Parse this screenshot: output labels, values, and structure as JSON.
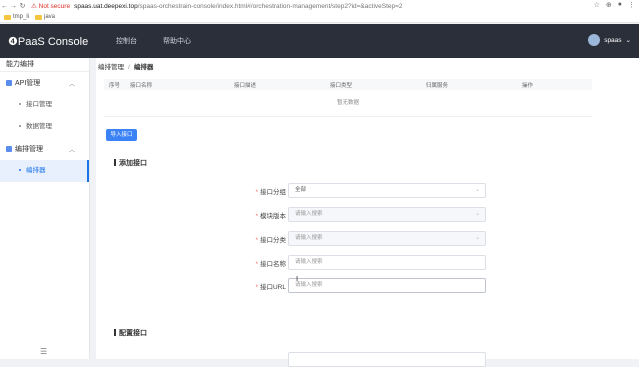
{
  "browser": {
    "nav": [
      "←",
      "→",
      "↻"
    ],
    "insecure_label": "Not secure",
    "url_main": "spaas.uat.deepexi.top",
    "url_rest": "/spaas-orchestrain-console/index.html#/orchestration-management/step2?id=&activeStep=2",
    "bookmarks": [
      "tmp_li",
      "java"
    ]
  },
  "header": {
    "logo": "❹PaaS Console",
    "menu": [
      "控制台",
      "帮助中心"
    ],
    "user": "spaas"
  },
  "sidebar": {
    "title": "能力编排",
    "groups": [
      {
        "label": "API管理",
        "items": [
          "接口管理",
          "数据管理"
        ]
      },
      {
        "label": "编排管理",
        "items": [
          "编排器"
        ]
      }
    ],
    "collapse_icon": "☰"
  },
  "breadcrumb": {
    "parent": "编排管理",
    "sep": "/",
    "current": "编排器"
  },
  "table": {
    "columns": [
      "序号",
      "接口名称",
      "接口描述",
      "接口类型",
      "归属服务",
      "操作"
    ],
    "empty_text": "暂无数据"
  },
  "import_button": "导入接口",
  "section_add": "添加接口",
  "section_config": "配置接口",
  "form": {
    "group_label": "接口分组",
    "group_value": "全部",
    "module_label": "模块版本",
    "module_placeholder": "请输入搜索",
    "category_label": "接口分类",
    "category_placeholder": "请输入搜索",
    "name_label": "接口名称",
    "name_placeholder": "请输入搜索",
    "url_label": "接口URL",
    "url_placeholder": "请输入搜索",
    "required_mark": "*"
  }
}
